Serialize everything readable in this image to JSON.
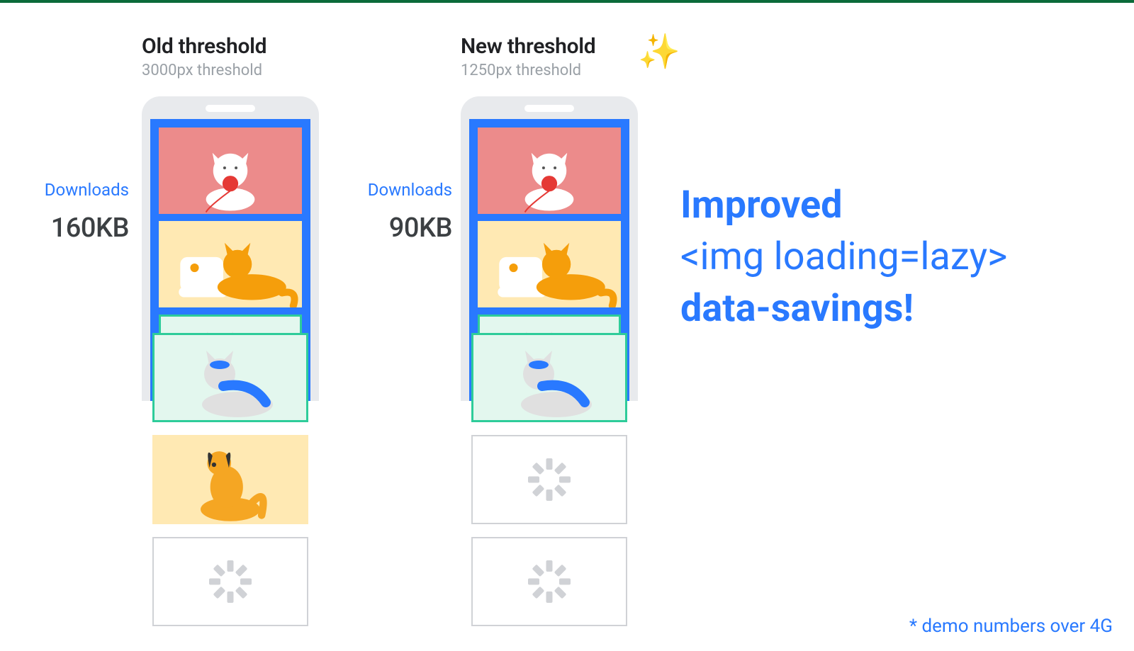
{
  "left": {
    "title": "Old threshold",
    "subtitle": "3000px threshold",
    "downloads_label": "Downloads",
    "downloads_value": "160KB",
    "below_fold_loaded": 2
  },
  "right": {
    "title": "New threshold",
    "subtitle": "1250px threshold",
    "downloads_label": "Downloads",
    "downloads_value": "90KB",
    "below_fold_loaded": 1
  },
  "message": {
    "line1": "Improved",
    "line2": "<img loading=lazy>",
    "line3": "data-savings!"
  },
  "footnote": "* demo numbers over 4G",
  "icons": {
    "sparkles": "✨"
  },
  "cards": {
    "cat_yarn": "white-cat-with-red-yarn",
    "cat_orange": "orange-cat-with-sneaker",
    "cat_blue": "white-cat-blue-collar",
    "dog_yellow": "yellow-dog-sitting",
    "placeholder": "loading-spinner"
  }
}
